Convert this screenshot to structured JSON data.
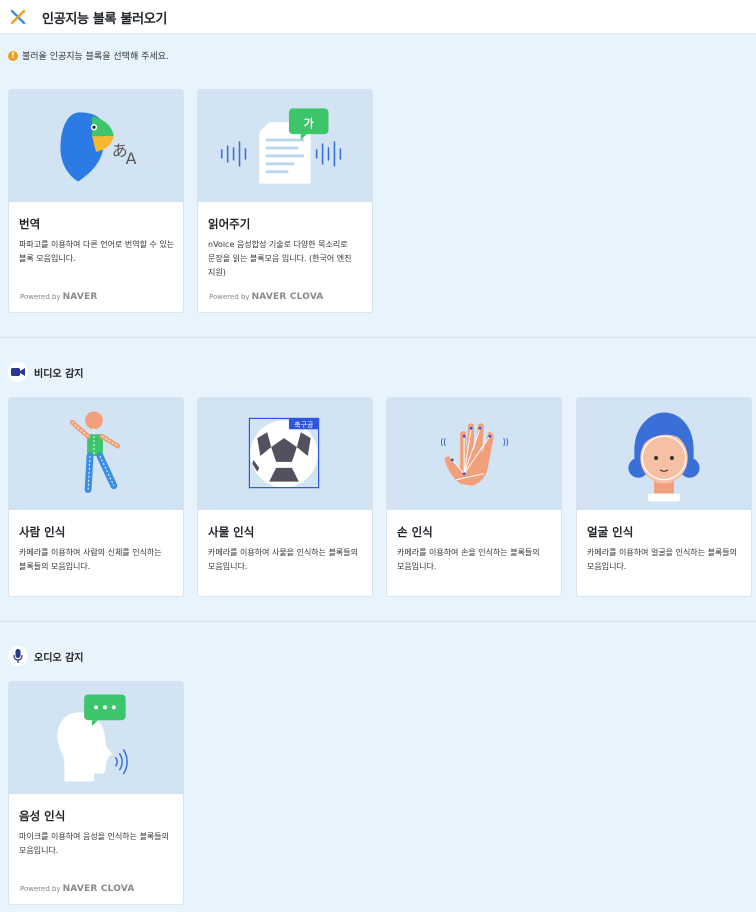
{
  "header": {
    "title": "인공지능 블록 불러오기"
  },
  "notice": {
    "text": "불러올 인공지능 블록을 선택해 주세요.",
    "icon": "!"
  },
  "sections": {
    "video": {
      "label": "비디오 감지"
    },
    "audio": {
      "label": "오디오 감지"
    }
  },
  "cards": {
    "translate": {
      "name": "번역",
      "desc": "파파고를 이용하여 다른 언어로 번역할 수 있는 블록 모음입니다.",
      "powered_prefix": "Powered by",
      "powered_brand": "NAVER"
    },
    "tts": {
      "name": "읽어주기",
      "desc": "nVoice 음성합성 기술로 다양한 목소리로 문장을 읽는 블록모음 입니다. (한국어 엔진 지원)",
      "powered_prefix": "Powered by",
      "powered_brand": "NAVER CLOVA",
      "bubble": "가"
    },
    "human": {
      "name": "사람 인식",
      "desc": "카메라를 이용하여 사람의 신체를 인식하는 블록들의 모음입니다."
    },
    "object": {
      "name": "사물 인식",
      "desc": "카메라를 이용하여 사물을 인식하는 블록들의 모음입니다.",
      "tag": "축구공"
    },
    "hand": {
      "name": "손 인식",
      "desc": "카메라를 이용하여 손을 인식하는 블록들의 모음입니다."
    },
    "face": {
      "name": "얼굴 인식",
      "desc": "카메라를 이용하여 얼굴을 인식하는 블록들의 모음입니다."
    },
    "voice": {
      "name": "음성 인식",
      "desc": "마이크를 이용하여 음성을 인식하는 블록들의 모음입니다.",
      "powered_prefix": "Powered by",
      "powered_brand": "NAVER CLOVA"
    }
  },
  "colors": {
    "accent": "#3a8ee6",
    "close": "#f0a020",
    "card_image_bg": "#d2e4f3",
    "page_bg": "#e8f4fd",
    "green": "#3cc56a"
  }
}
